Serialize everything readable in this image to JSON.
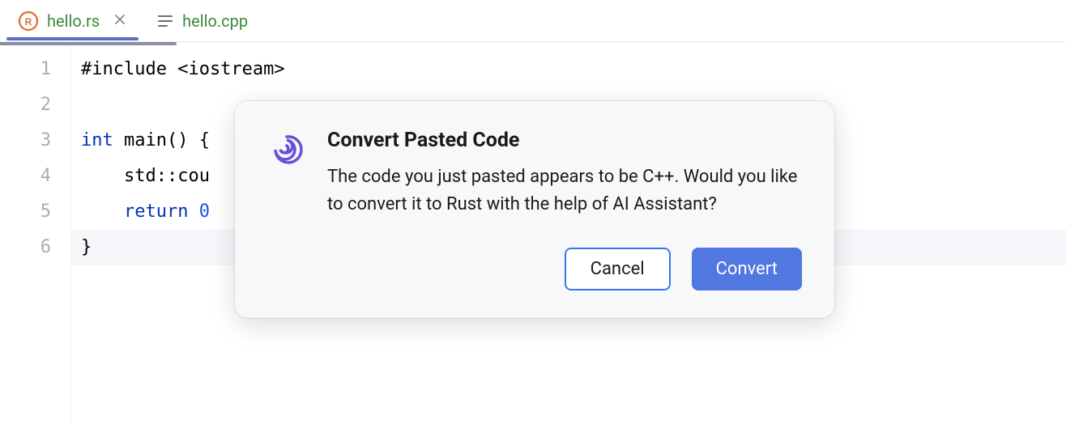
{
  "tabs": {
    "active": {
      "label": "hello.rs",
      "icon": "rust-icon"
    },
    "inactive": {
      "label": "hello.cpp",
      "icon": "file-lines-icon"
    }
  },
  "editor": {
    "gutter": [
      "1",
      "2",
      "3",
      "4",
      "5",
      "6"
    ],
    "lines": {
      "l1_include": "#include <iostream>",
      "l2_empty": "",
      "l3_prefix": "int",
      "l3_main": " main() {",
      "l4_cout": "    std::cou",
      "l5_indent": "    ",
      "l5_return": "return",
      "l5_space": " ",
      "l5_zero": "0",
      "l6_brace": "}"
    },
    "highlighted_line": 6
  },
  "dialog": {
    "title": "Convert Pasted Code",
    "body": "The code you just pasted appears to be C++. Would you like to convert it to Rust with the help of AI Assistant?",
    "buttons": {
      "cancel": "Cancel",
      "confirm": "Convert"
    },
    "icon": "ai-spiral-icon"
  },
  "colors": {
    "accent_green": "#3a8a3a",
    "accent_blue": "#5177e0",
    "keyword": "#0033b3",
    "number": "#1750eb",
    "rust_orange": "#e06c3c",
    "ai_purple": "#6b4fd8"
  }
}
